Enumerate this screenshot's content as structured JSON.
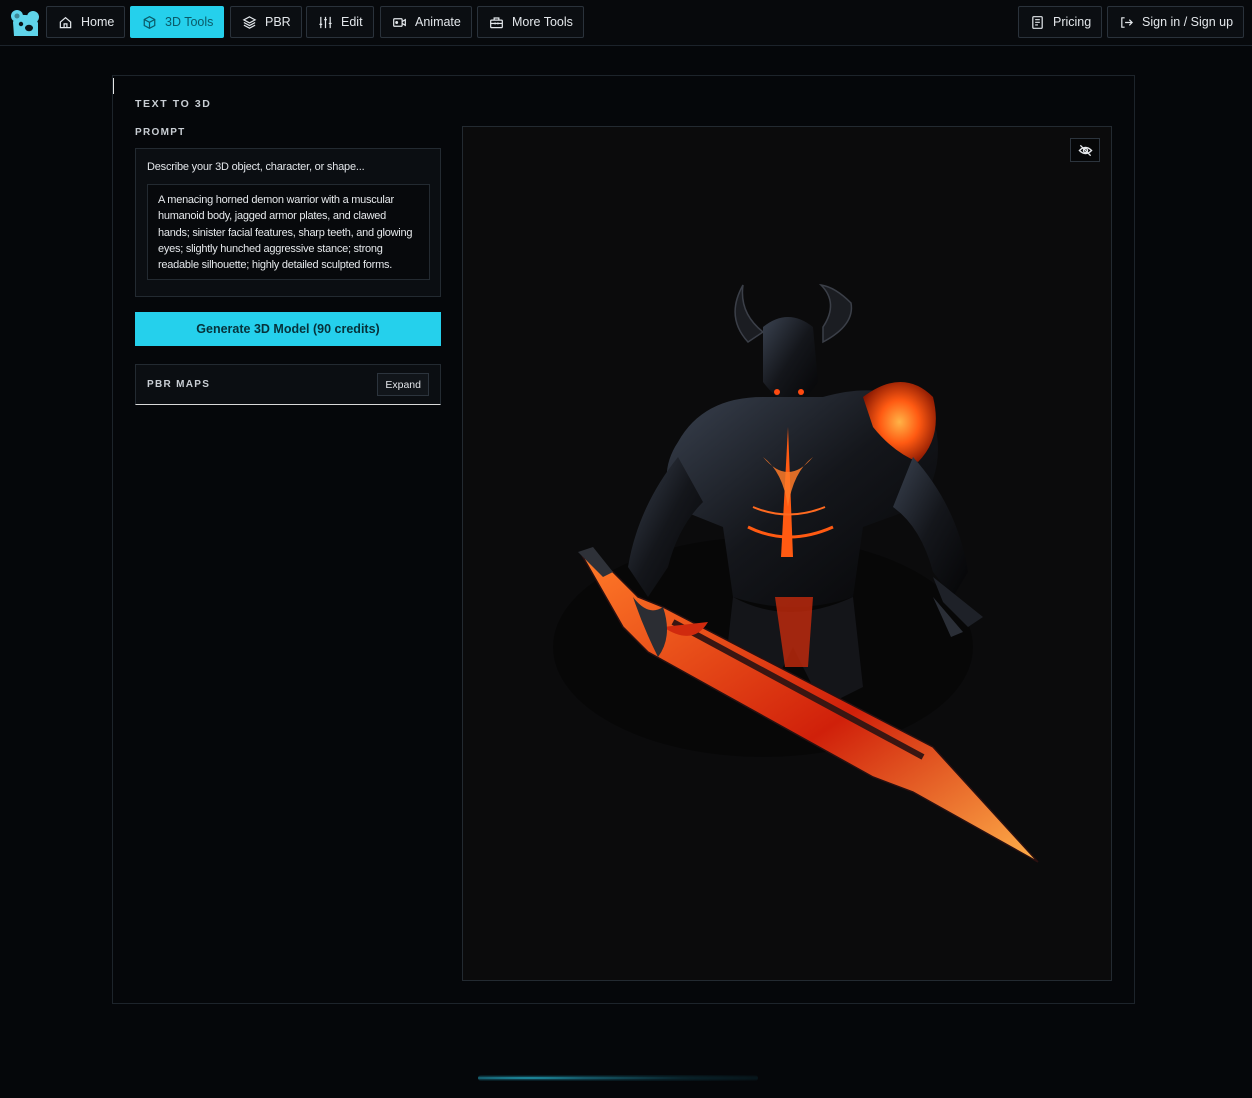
{
  "nav": {
    "home": "Home",
    "tools_3d": "3D Tools",
    "pbr": "PBR",
    "edit": "Edit",
    "animate": "Animate",
    "more_tools": "More Tools",
    "pricing": "Pricing",
    "sign_in": "Sign in / Sign up"
  },
  "tool": {
    "title": "TEXT TO 3D",
    "prompt_label": "PROMPT",
    "prompt_placeholder": "Describe your 3D object, character, or shape...",
    "prompt_value": "A menacing horned demon warrior with a muscular humanoid body, jagged armor plates, and clawed hands; sinister facial features, sharp teeth, and glowing eyes; slightly hunched aggressive stance; strong readable silhouette; highly detailed sculpted forms.",
    "generate_button": "Generate 3D Model (90 credits)",
    "pbr_label": "PBR MAPS",
    "expand_button": "Expand"
  },
  "colors": {
    "accent": "#25d0ec",
    "background": "#05070a",
    "panel": "#0b0e12"
  },
  "icons": {
    "logo": "koala-logo",
    "home": "home-icon",
    "tools_3d": "cube-icon",
    "pbr": "layers-icon",
    "edit": "sliders-icon",
    "animate": "video-icon",
    "more_tools": "toolbox-icon",
    "pricing": "document-icon",
    "sign_in": "sign-in-icon",
    "viewer_toggle": "eye-off-icon"
  }
}
